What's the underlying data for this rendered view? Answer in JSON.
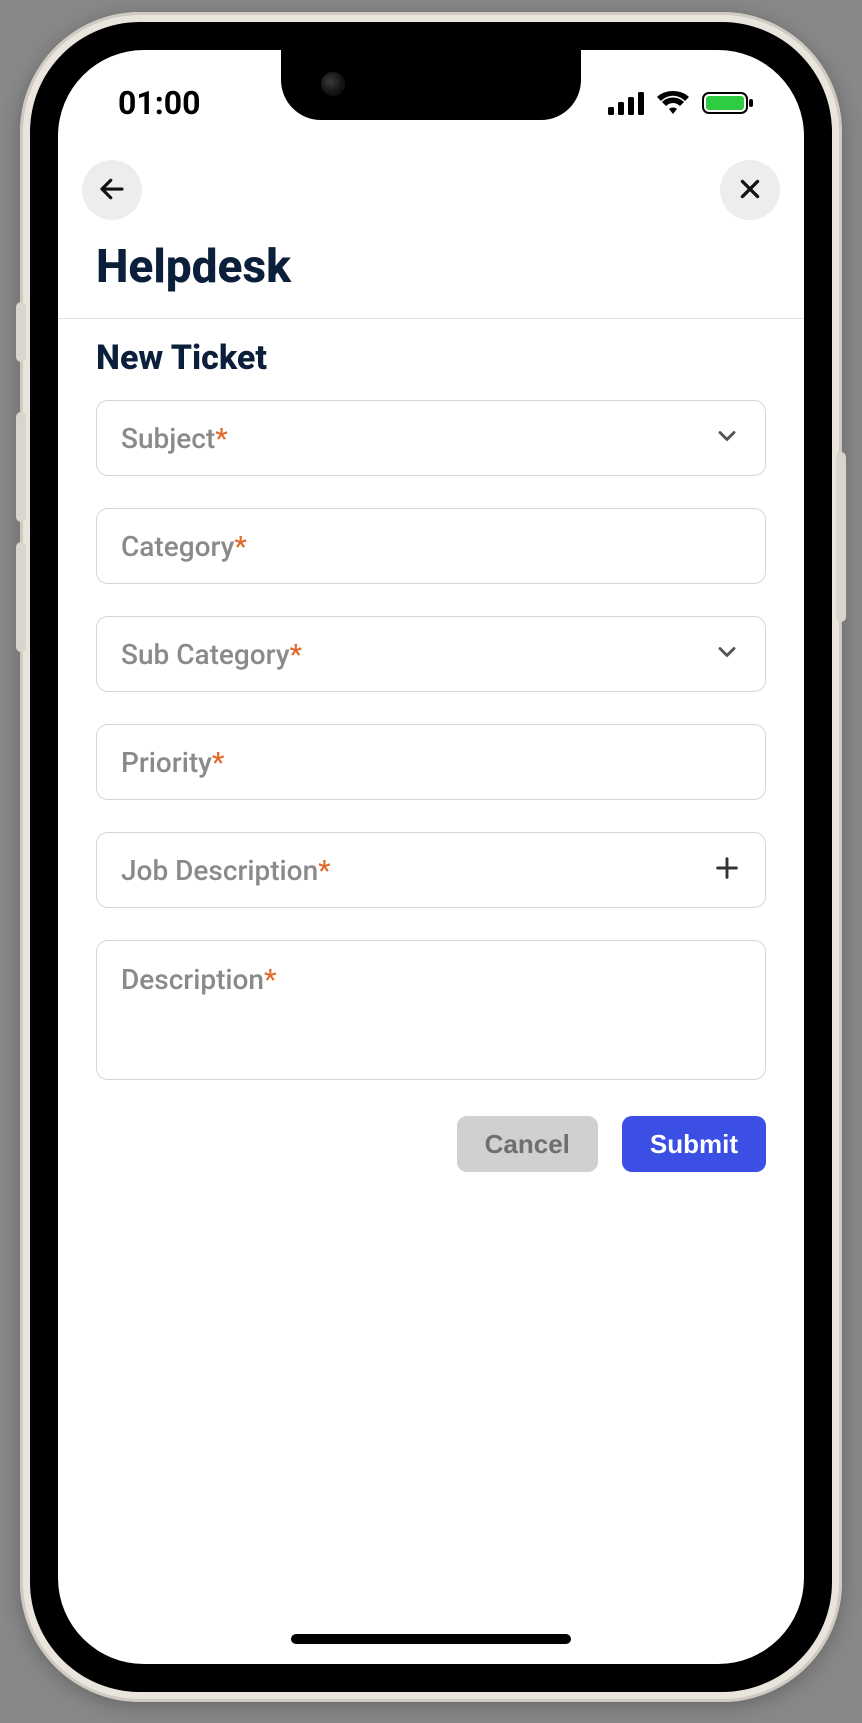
{
  "status": {
    "time": "01:00"
  },
  "header": {
    "title": "Helpdesk"
  },
  "section": {
    "title": "New Ticket"
  },
  "form": {
    "subject": {
      "label": "Subject",
      "required": true
    },
    "category": {
      "label": "Category",
      "required": true
    },
    "sub_category": {
      "label": "Sub Category",
      "required": true
    },
    "priority": {
      "label": "Priority",
      "required": true
    },
    "job_description": {
      "label": "Job Description",
      "required": true
    },
    "description": {
      "label": "Description",
      "required": true
    }
  },
  "actions": {
    "cancel": "Cancel",
    "submit": "Submit"
  },
  "icons": {
    "back": "arrow-left",
    "close": "x",
    "chevron": "chevron-down",
    "plus": "plus",
    "signal": "cellular",
    "wifi": "wifi",
    "battery": "battery-full"
  }
}
